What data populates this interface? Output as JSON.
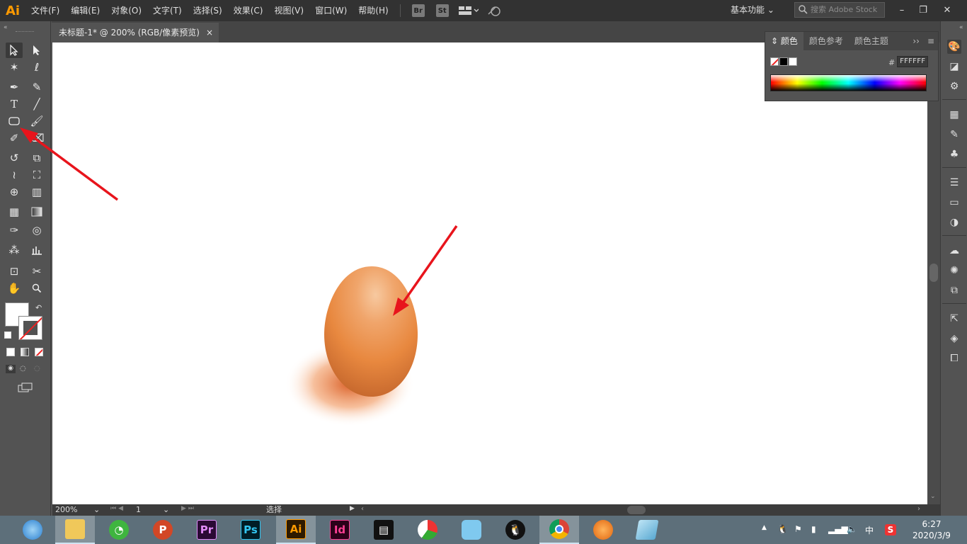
{
  "app": {
    "logo": "Ai"
  },
  "menu": [
    "文件(F)",
    "编辑(E)",
    "对象(O)",
    "文字(T)",
    "选择(S)",
    "效果(C)",
    "视图(V)",
    "窗口(W)",
    "帮助(H)"
  ],
  "menubar_buttons": {
    "bridge": "Br",
    "stock": "St"
  },
  "workspace": {
    "label": "基本功能"
  },
  "search": {
    "placeholder": "搜索 Adobe Stock"
  },
  "document": {
    "tab_title": "未标题-1* @ 200% (RGB/像素预览)",
    "close": "×"
  },
  "color_panel": {
    "tabs": [
      "颜色",
      "颜色参考",
      "颜色主题"
    ],
    "hex_label": "#",
    "hex_value": "FFFFFF"
  },
  "status_bar": {
    "zoom": "200%",
    "page": "1",
    "status": "选择"
  },
  "taskbar": {
    "time": "6:27",
    "date": "2020/3/9",
    "ime": "中"
  },
  "colors": {
    "accent_ai": "#ff9a00",
    "arrow": "#e8141c",
    "egg": "#e98a45"
  }
}
